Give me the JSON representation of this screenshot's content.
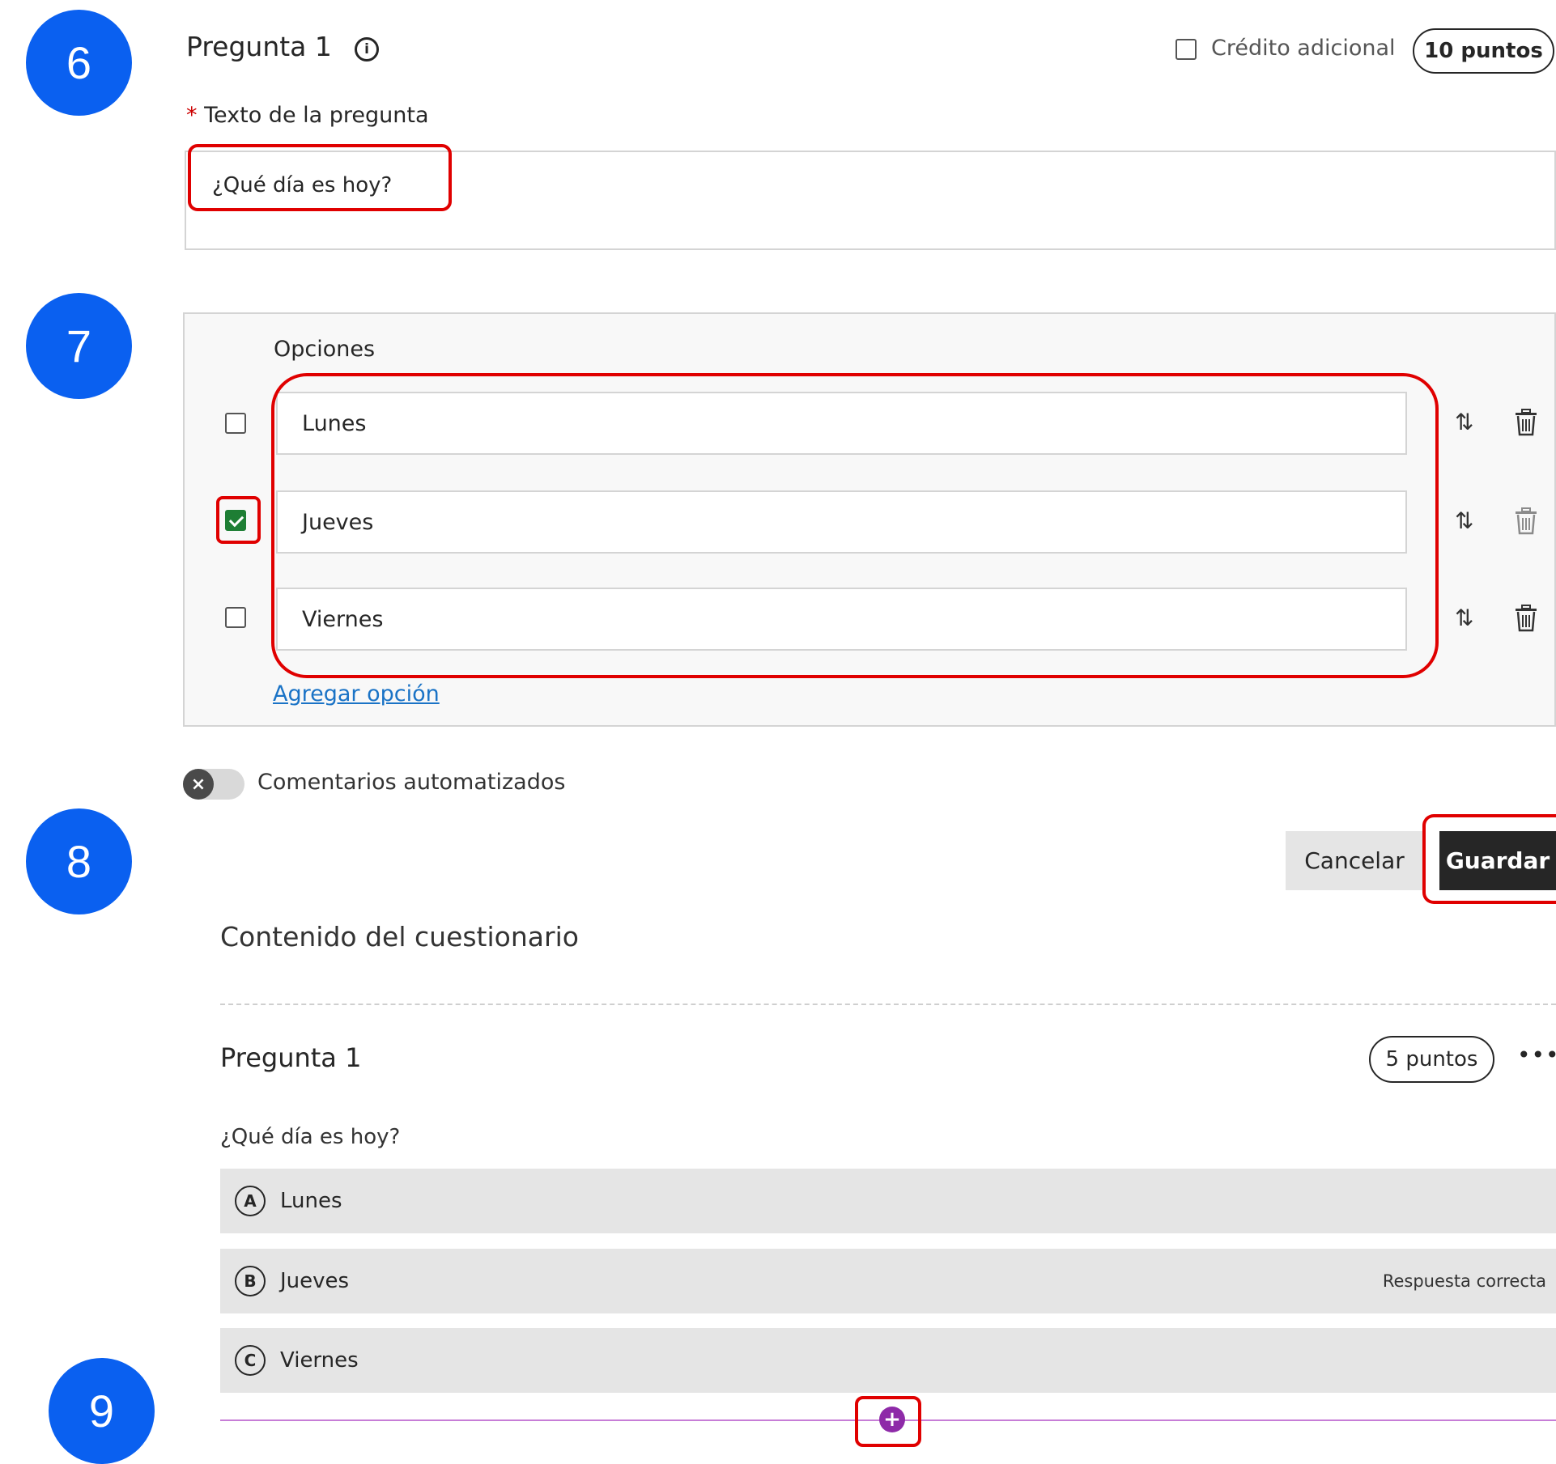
{
  "steps": [
    "6",
    "7",
    "8",
    "9"
  ],
  "question_editor": {
    "title": "Pregunta 1",
    "info_icon": "info-circle-icon",
    "extra_credit_label": "Crédito adicional",
    "points": "10 puntos",
    "required_marker": "*",
    "question_text_label": "Texto de la pregunta",
    "question_text_value": "¿Qué día es hoy?",
    "options_label": "Opciones",
    "options": [
      {
        "label": "Lunes",
        "correct": false
      },
      {
        "label": "Jueves",
        "correct": true
      },
      {
        "label": "Viernes",
        "correct": false
      }
    ],
    "reorder_icon": "reorder-arrows-icon",
    "delete_icon": "trash-icon",
    "add_option": "Agregar opción",
    "feedback_toggle_label": "Comentarios automatizados",
    "cancel_button": "Cancelar",
    "save_button": "Guardar"
  },
  "quiz_content": {
    "section_title": "Contenido del cuestionario",
    "question_title": "Pregunta 1",
    "points": "5 puntos",
    "more_icon": "ellipsis-icon",
    "question_text": "¿Qué día es hoy?",
    "answers": [
      {
        "letter": "A",
        "label": "Lunes",
        "note": ""
      },
      {
        "letter": "B",
        "label": "Jueves",
        "note": "Respuesta correcta"
      },
      {
        "letter": "C",
        "label": "Viernes",
        "note": ""
      }
    ],
    "add_question_icon": "plus-circle-icon"
  },
  "colors": {
    "badge": "#0a60f0",
    "highlight": "#e00000",
    "correct_check": "#1e7e34",
    "insert_line": "#c77dd7",
    "save_bg": "#262626"
  }
}
